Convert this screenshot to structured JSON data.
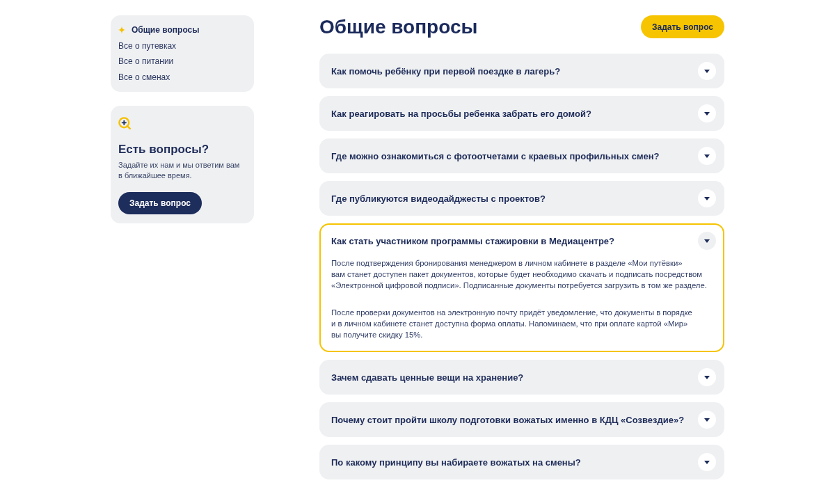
{
  "sidebar": {
    "nav": [
      {
        "label": "Общие вопросы",
        "selected": true
      },
      {
        "label": "Все о путевках",
        "selected": false
      },
      {
        "label": "Все о питании",
        "selected": false
      },
      {
        "label": "Все о сменах",
        "selected": false
      }
    ],
    "contact": {
      "title": "Есть вопросы?",
      "text": "Задайте их нам и мы ответим вам\nв ближайшее время.",
      "button": "Задать вопрос"
    }
  },
  "main": {
    "title": "Общие вопросы",
    "ask_button": "Задать вопрос",
    "faq": [
      {
        "question": "Как помочь ребёнку при первой поездке в лагерь?",
        "expanded": false
      },
      {
        "question": "Как реагировать на просьбы ребенка забрать его домой?",
        "expanded": false
      },
      {
        "question": "Где можно ознакомиться с фотоотчетами с краевых профильных смен?",
        "expanded": false
      },
      {
        "question": "Где публикуются видеодайджесты с проектов?",
        "expanded": false
      },
      {
        "question": "Как стать участником программы стажировки в Медиацентре?",
        "expanded": true,
        "answer": [
          "После подтверждения бронирования менеджером в личном кабинете в разделе «Мои путёвки»\nвам станет доступен пакет документов, которые будет необходимо скачать и подписать посредством\n«Электронной цифровой подписи». Подписанные документы потребуется загрузить в том же разделе.",
          "После проверки документов на электронную почту придёт уведомление, что документы в порядке\nи в личном кабинете станет доступна форма оплаты. Напоминаем, что при оплате картой «Мир»\nвы получите скидку 15%."
        ]
      },
      {
        "question": "Зачем сдавать ценные вещи на хранение?",
        "expanded": false
      },
      {
        "question": "Почему стоит пройти школу подготовки вожатых именно в КДЦ «Созвездие»?",
        "expanded": false
      },
      {
        "question": "По какому принципу вы набираете вожатых на смены?",
        "expanded": false
      }
    ]
  }
}
